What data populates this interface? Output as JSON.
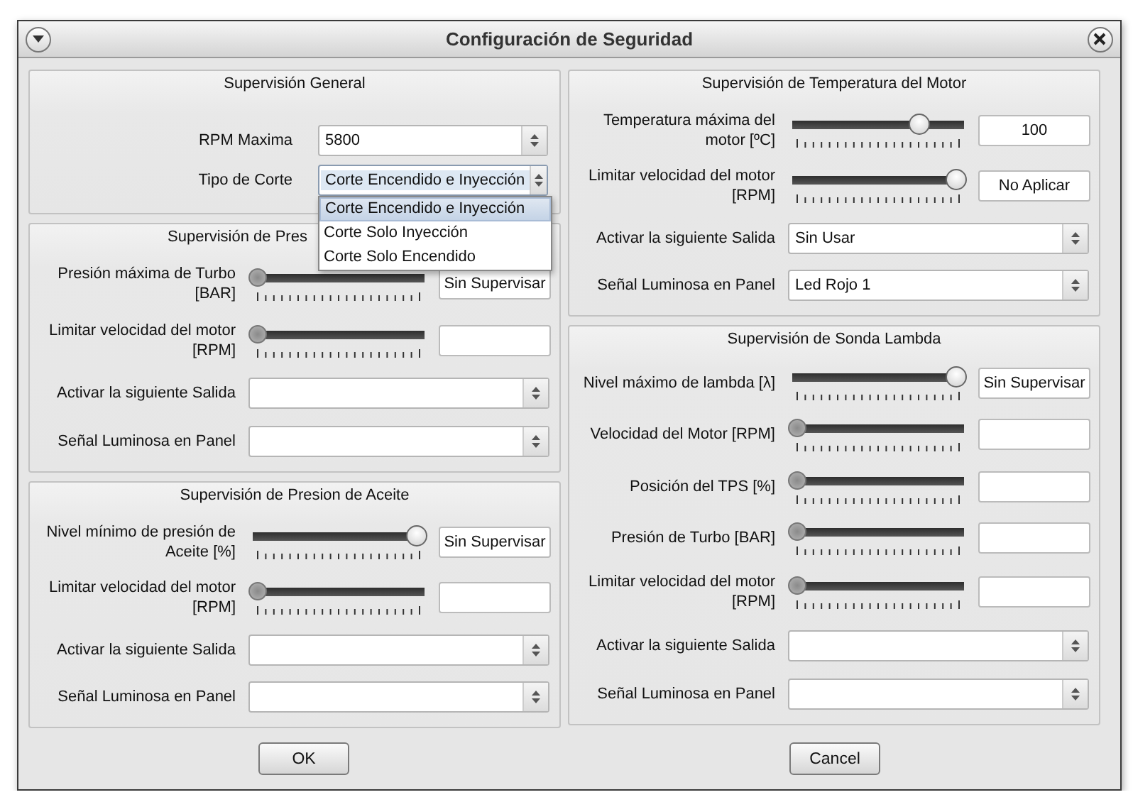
{
  "window": {
    "title": "Configuración de Seguridad"
  },
  "columns": [
    {
      "groups": [
        {
          "title": "Supervisión General",
          "rows": [
            {
              "kind": "spin",
              "label": "RPM Maxima",
              "value": "5800"
            },
            {
              "kind": "combo",
              "label": "Tipo de Corte",
              "value": "Corte Encendido e Inyección",
              "highlighted": true,
              "open": true,
              "options": [
                {
                  "label": "Corte Encendido e Inyección",
                  "selected": true
                },
                {
                  "label": "Corte Solo Inyección",
                  "selected": false
                },
                {
                  "label": "Corte Solo Encendido",
                  "selected": false
                }
              ]
            }
          ]
        },
        {
          "title": "Supervisión de Pres",
          "covered": true,
          "rows": [
            {
              "kind": "slider",
              "label": "Presión máxima de Turbo\n[BAR]",
              "level": 0,
              "value": "Sin Supervisar"
            },
            {
              "kind": "slider",
              "label": "Limitar velocidad del motor\n[RPM]",
              "level": 0,
              "value": ""
            },
            {
              "kind": "combo",
              "label": "Activar la siguiente Salida",
              "value": ""
            },
            {
              "kind": "combo",
              "label": "Señal Luminosa en Panel",
              "value": ""
            }
          ]
        },
        {
          "title": "Supervisión de Presion de Aceite",
          "rows": [
            {
              "kind": "slider",
              "label": "Nivel mínimo de presión de\nAceite [%]",
              "level": 1,
              "value": "Sin Supervisar"
            },
            {
              "kind": "slider",
              "label": "Limitar velocidad del motor\n[RPM]",
              "level": 0,
              "value": ""
            },
            {
              "kind": "combo",
              "label": "Activar la siguiente Salida",
              "value": ""
            },
            {
              "kind": "combo",
              "label": "Señal Luminosa en Panel",
              "value": ""
            }
          ]
        }
      ]
    },
    {
      "groups": [
        {
          "title": "Supervisión de Temperatura del Motor",
          "rows": [
            {
              "kind": "slider",
              "label": "Temperatura máxima del\nmotor [ºC]",
              "level": 0.77,
              "value": "100"
            },
            {
              "kind": "slider",
              "label": "Limitar velocidad del motor\n[RPM]",
              "level": 1,
              "value": "No Aplicar"
            },
            {
              "kind": "combo",
              "label": "Activar la siguiente Salida",
              "value": "Sin Usar"
            },
            {
              "kind": "combo",
              "label": "Señal Luminosa en Panel",
              "value": "Led Rojo 1"
            }
          ]
        },
        {
          "title": "Supervisión de Sonda Lambda",
          "rows": [
            {
              "kind": "slider",
              "label": "Nivel máximo de lambda [λ]",
              "level": 1,
              "value": "Sin Supervisar"
            },
            {
              "kind": "slider",
              "label": "Velocidad del Motor [RPM]",
              "level": 0,
              "value": ""
            },
            {
              "kind": "slider",
              "label": "Posición del TPS [%]",
              "level": 0,
              "value": ""
            },
            {
              "kind": "slider",
              "label": "Presión de Turbo [BAR]",
              "level": 0,
              "value": ""
            },
            {
              "kind": "slider",
              "label": "Limitar velocidad del motor\n[RPM]",
              "level": 0,
              "value": ""
            },
            {
              "kind": "combo",
              "label": "Activar la siguiente Salida",
              "value": ""
            },
            {
              "kind": "combo",
              "label": "Señal Luminosa en Panel",
              "value": ""
            }
          ]
        }
      ]
    }
  ],
  "buttons": [
    "OK",
    "Cancel"
  ]
}
